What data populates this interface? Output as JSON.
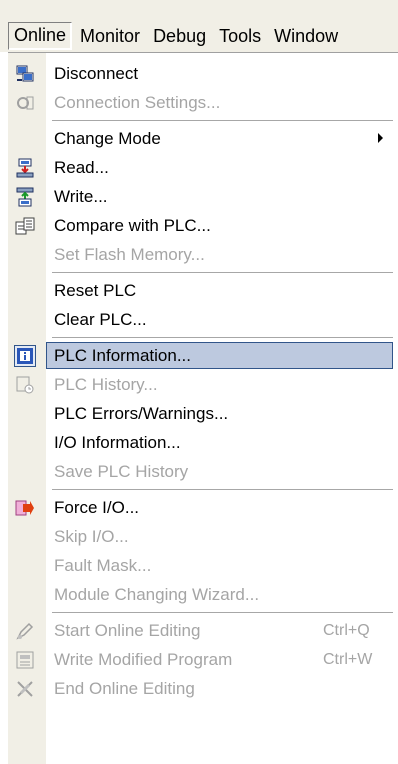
{
  "menubar": {
    "items": [
      {
        "label": "Online"
      },
      {
        "label": "Monitor"
      },
      {
        "label": "Debug"
      },
      {
        "label": "Tools"
      },
      {
        "label": "Window"
      }
    ]
  },
  "menu": {
    "items": [
      {
        "label": "Disconnect",
        "icon": "disconnect-icon",
        "enabled": true
      },
      {
        "label": "Connection Settings...",
        "icon": "connection-settings-icon",
        "enabled": false
      },
      {
        "label": "Change Mode",
        "enabled": true,
        "submenu": true
      },
      {
        "label": "Read...",
        "icon": "read-icon",
        "enabled": true
      },
      {
        "label": "Write...",
        "icon": "write-icon",
        "enabled": true
      },
      {
        "label": "Compare with PLC...",
        "icon": "compare-icon",
        "enabled": true
      },
      {
        "label": "Set Flash Memory...",
        "enabled": false
      },
      {
        "label": "Reset PLC",
        "enabled": true
      },
      {
        "label": "Clear PLC...",
        "enabled": true
      },
      {
        "label": "PLC Information...",
        "icon": "plc-information-icon",
        "enabled": true,
        "selected": true
      },
      {
        "label": "PLC History...",
        "icon": "plc-history-icon",
        "enabled": false
      },
      {
        "label": "PLC Errors/Warnings...",
        "enabled": true
      },
      {
        "label": "I/O Information...",
        "enabled": true
      },
      {
        "label": "Save PLC History",
        "enabled": false
      },
      {
        "label": "Force I/O...",
        "icon": "force-io-icon",
        "enabled": true
      },
      {
        "label": "Skip I/O...",
        "enabled": false
      },
      {
        "label": "Fault Mask...",
        "enabled": false
      },
      {
        "label": "Module Changing Wizard...",
        "enabled": false
      },
      {
        "label": "Start Online Editing",
        "shortcut": "Ctrl+Q",
        "icon": "start-online-editing-icon",
        "enabled": false
      },
      {
        "label": "Write Modified Program",
        "shortcut": "Ctrl+W",
        "icon": "write-modified-program-icon",
        "enabled": false
      },
      {
        "label": "End Online Editing",
        "icon": "end-online-editing-icon",
        "enabled": false
      }
    ]
  },
  "colors": {
    "menubar_bg": "#f1efe6",
    "selection_bg": "#bdc9df",
    "selection_border": "#31558a",
    "disabled_text": "#a5a5a5"
  }
}
